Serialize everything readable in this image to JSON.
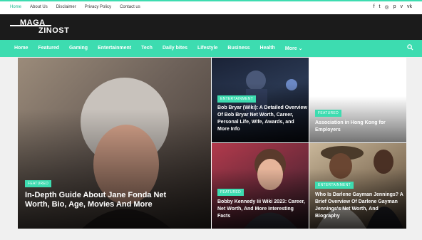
{
  "topnav": {
    "items": [
      "Home",
      "About Us",
      "Disclaimer",
      "Privacy Policy",
      "Contact us"
    ]
  },
  "social": {
    "icons": [
      "facebook-icon",
      "twitter-icon",
      "instagram-icon",
      "pinterest-icon",
      "vimeo-icon",
      "vk-icon"
    ],
    "glyphs": [
      "f",
      "t",
      "◎",
      "p",
      "v",
      "vk"
    ]
  },
  "logo": {
    "line1": "MAGA",
    "line2": "ZINOST"
  },
  "mainnav": {
    "items": [
      "Home",
      "Featured",
      "Gaming",
      "Entertainment",
      "Tech",
      "Daily bites",
      "Lifestyle",
      "Business",
      "Health",
      "More ⌄"
    ]
  },
  "posts": [
    {
      "badge": "FEATURED",
      "title": "In-Depth Guide About Jane Fonda Net Worth, Bio, Age, Movies And More"
    },
    {
      "badge": "ENTERTAINMENT",
      "title": "Bob Bryar (Wiki): A Detailed Overview Of Bob Bryar Net Worth, Career, Personal Life, Wife, Awards, and More Info"
    },
    {
      "badge": "FEATURED",
      "title": "Association in Hong Kong for Employers"
    },
    {
      "badge": "FEATURED",
      "title": "Bobby Kennedy Iii Wiki 2023: Career, Net Worth, And More Interesting Facts"
    },
    {
      "badge": "ENTERTAINMENT",
      "title": "Who Is Darlene Gayman Jennings? A Brief Overview Of Darlene Gayman Jennings's Net Worth, And Biography"
    }
  ],
  "colors": {
    "accent": "#3ddcb0",
    "header_bg": "#1b1b1b"
  }
}
